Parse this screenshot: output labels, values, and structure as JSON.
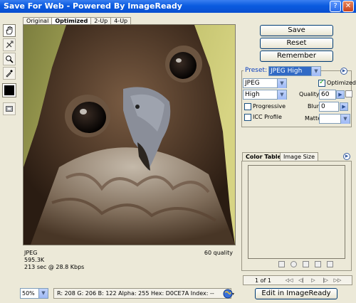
{
  "window": {
    "title": "Save For Web - Powered By ImageReady"
  },
  "tabs": [
    {
      "label": "Original"
    },
    {
      "label": "Optimized"
    },
    {
      "label": "2-Up"
    },
    {
      "label": "4-Up"
    }
  ],
  "active_tab": "Optimized",
  "tools": [
    "hand-icon",
    "slice-select-icon",
    "zoom-icon",
    "eyedropper-icon",
    "eyedropper-color-swatch",
    "toggle-slice-visibility-icon"
  ],
  "preview_info": {
    "format": "JPEG",
    "size": "595.3K",
    "time": "213 sec @ 28.8 Kbps",
    "quality": "60 quality"
  },
  "buttons": {
    "save": "Save",
    "reset": "Reset",
    "remember": "Remember",
    "edit_in_imageready": "Edit in ImageReady"
  },
  "settings": {
    "preset_label": "Preset:",
    "preset_value": "JPEG High",
    "format_value": "JPEG",
    "quality_level_value": "High",
    "optimized_label": "Optimized",
    "optimized_checked": true,
    "quality_label": "Quality:",
    "quality_value": "60",
    "progressive_label": "Progressive",
    "progressive_checked": false,
    "blur_label": "Blur:",
    "blur_value": "0",
    "icc_profile_label": "ICC Profile",
    "icc_profile_checked": false,
    "matte_label": "Matte:",
    "matte_value": ""
  },
  "color_panel": {
    "tabs": [
      "Color Table",
      "Image Size"
    ],
    "active": "Color Table"
  },
  "pager": {
    "label": "1 of 1",
    "nav_icons": [
      "first-icon",
      "previous-icon",
      "step-back-icon",
      "play-icon",
      "step-forward-icon",
      "last-icon"
    ]
  },
  "status": {
    "zoom": "50%",
    "readout": "R: 208   G: 206   B: 122   Alpha: 255   Hex: D0CE7A   Index: --"
  },
  "colors": {
    "titlebar": "#0a5be0",
    "button_border": "#003c74",
    "preset_highlight": "#316ac5"
  }
}
